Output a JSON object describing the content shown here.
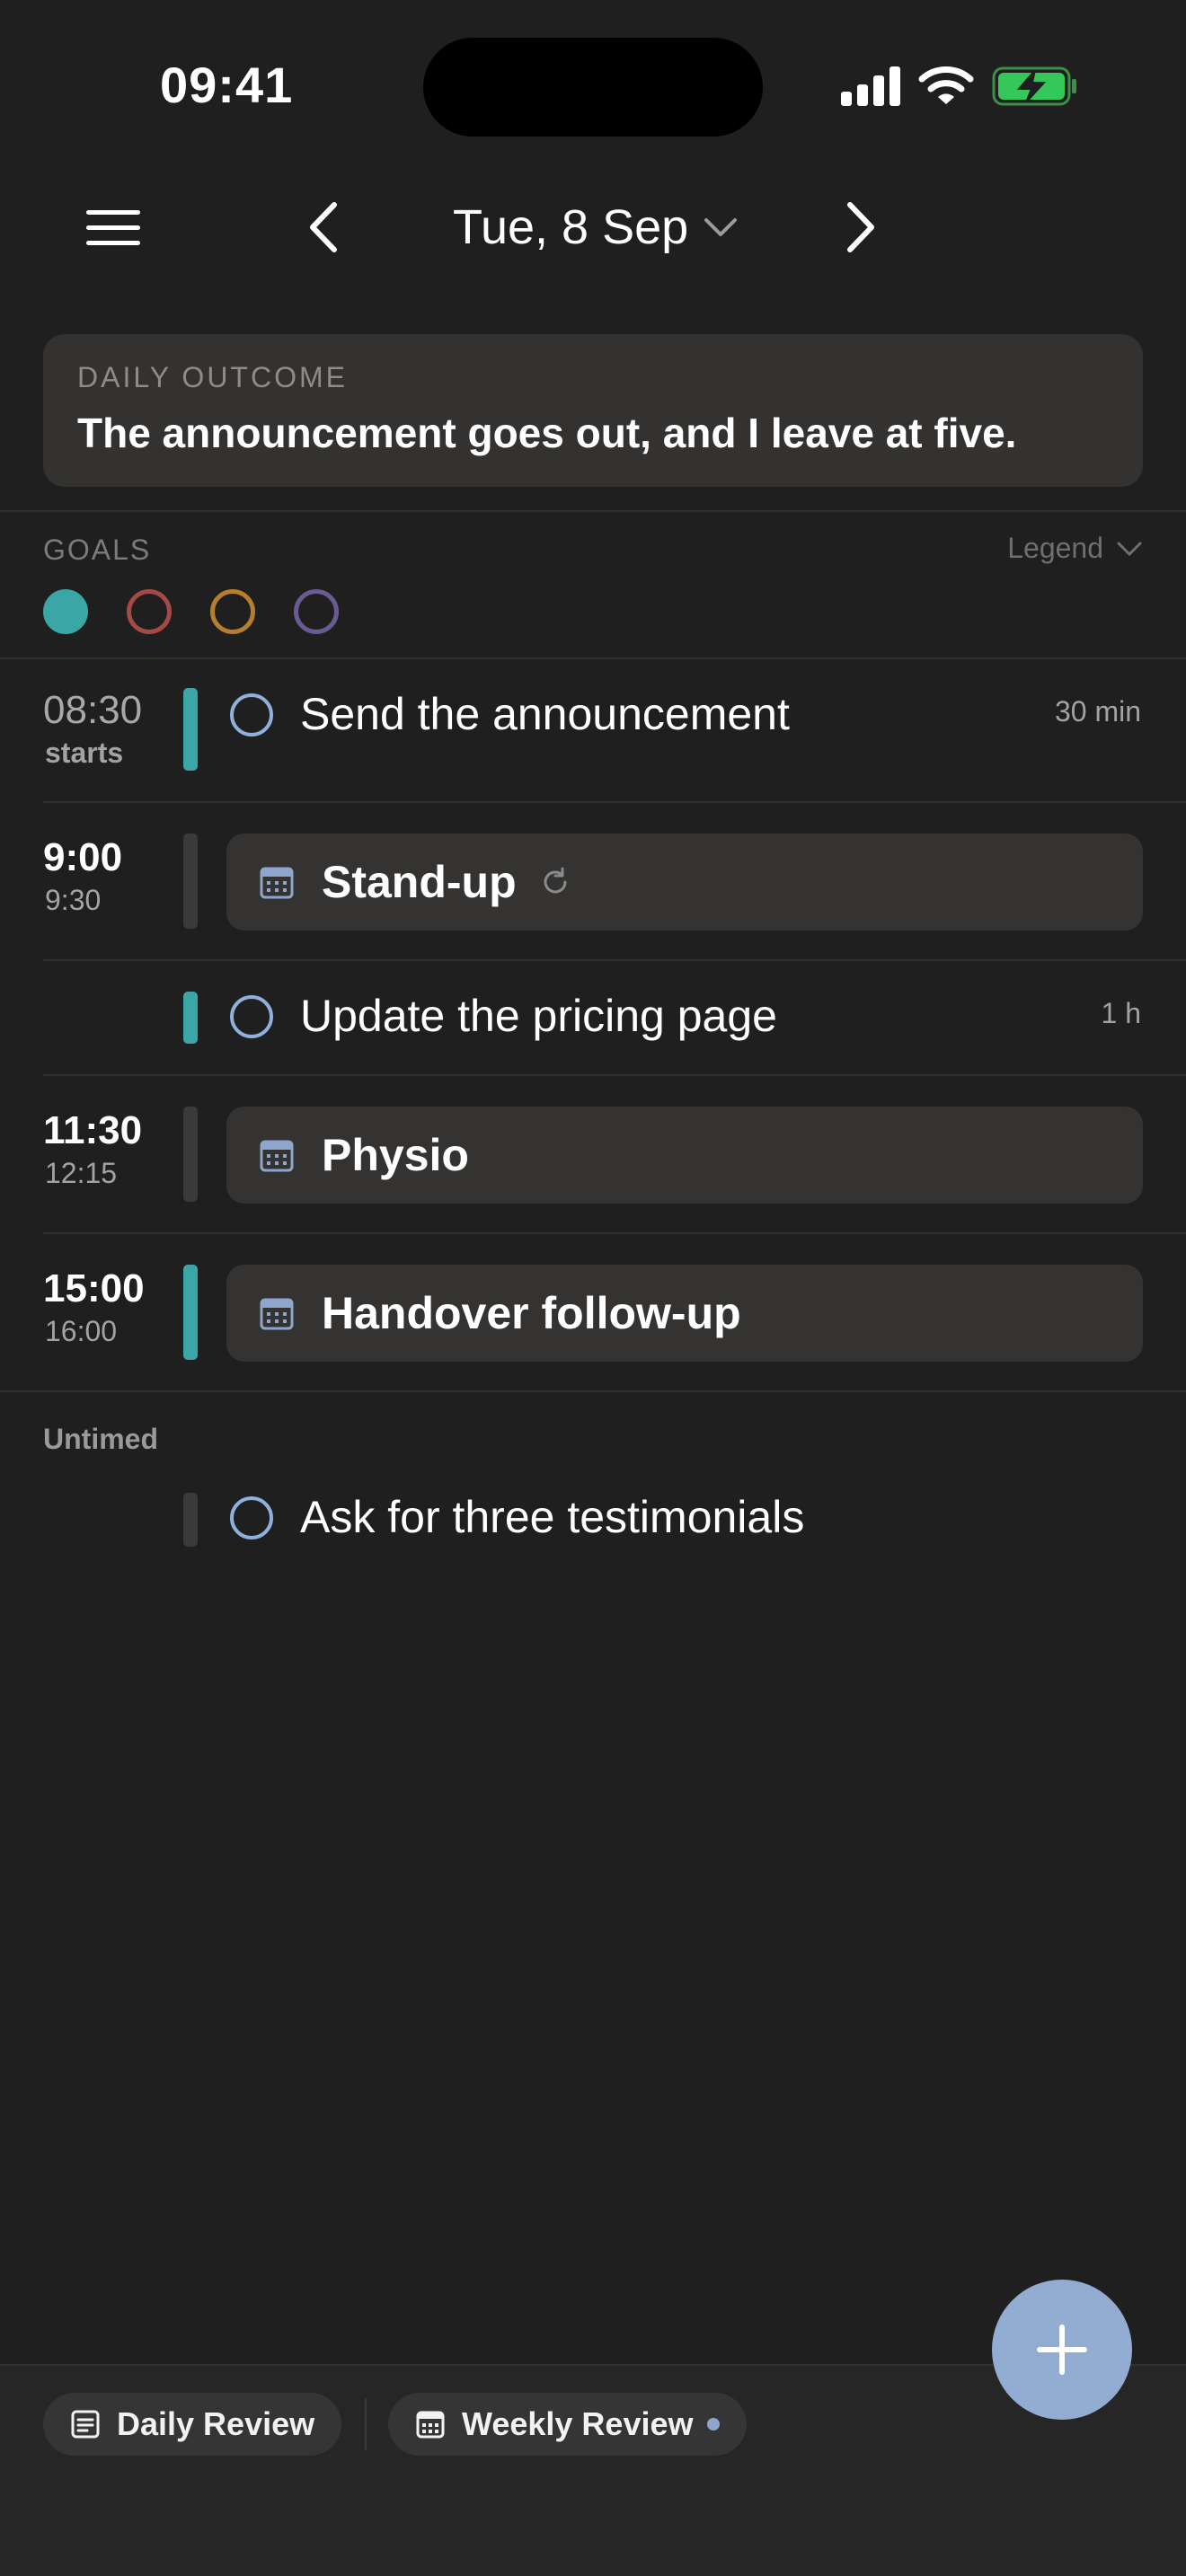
{
  "status_bar": {
    "time": "09:41"
  },
  "header": {
    "date": "Tue, 8 Sep"
  },
  "outcome": {
    "title": "DAILY OUTCOME",
    "text": "The announcement goes out, and I leave at five."
  },
  "goals": {
    "label": "GOALS",
    "legend_label": "Legend",
    "dots": [
      {
        "color": "#3ba6a6",
        "filled": true
      },
      {
        "color": "#a34a44",
        "filled": false
      },
      {
        "color": "#b57d2c",
        "filled": false
      },
      {
        "color": "#6b5b94",
        "filled": false
      }
    ]
  },
  "timeline": [
    {
      "kind": "task",
      "time": "08:30",
      "time_sub": "starts",
      "title": "Send the announcement",
      "duration": "30 min",
      "bar_color": "#3ba6a6"
    },
    {
      "kind": "event",
      "time": "9:00",
      "time_sub": "9:30",
      "title": "Stand-up",
      "repeat": true,
      "bar_color": "#3a3a3a"
    },
    {
      "kind": "task",
      "title": "Update the pricing page",
      "duration": "1 h",
      "bar_color": "#3ba6a6"
    },
    {
      "kind": "event",
      "time": "11:30",
      "time_sub": "12:15",
      "title": "Physio",
      "bar_color": "#3a3a3a"
    },
    {
      "kind": "event",
      "time": "15:00",
      "time_sub": "16:00",
      "title": "Handover follow-up",
      "bar_color": "#3ba6a6"
    }
  ],
  "untimed": {
    "label": "Untimed",
    "items": [
      {
        "title": "Ask for three testimonials",
        "bar_color": "#3a3a3a"
      }
    ]
  },
  "bottom_bar": {
    "daily_review": "Daily Review",
    "weekly_review": "Weekly Review"
  },
  "colors": {
    "accent": "#93acd2",
    "teal": "#3ba6a6",
    "background": "#1f1f1f"
  }
}
